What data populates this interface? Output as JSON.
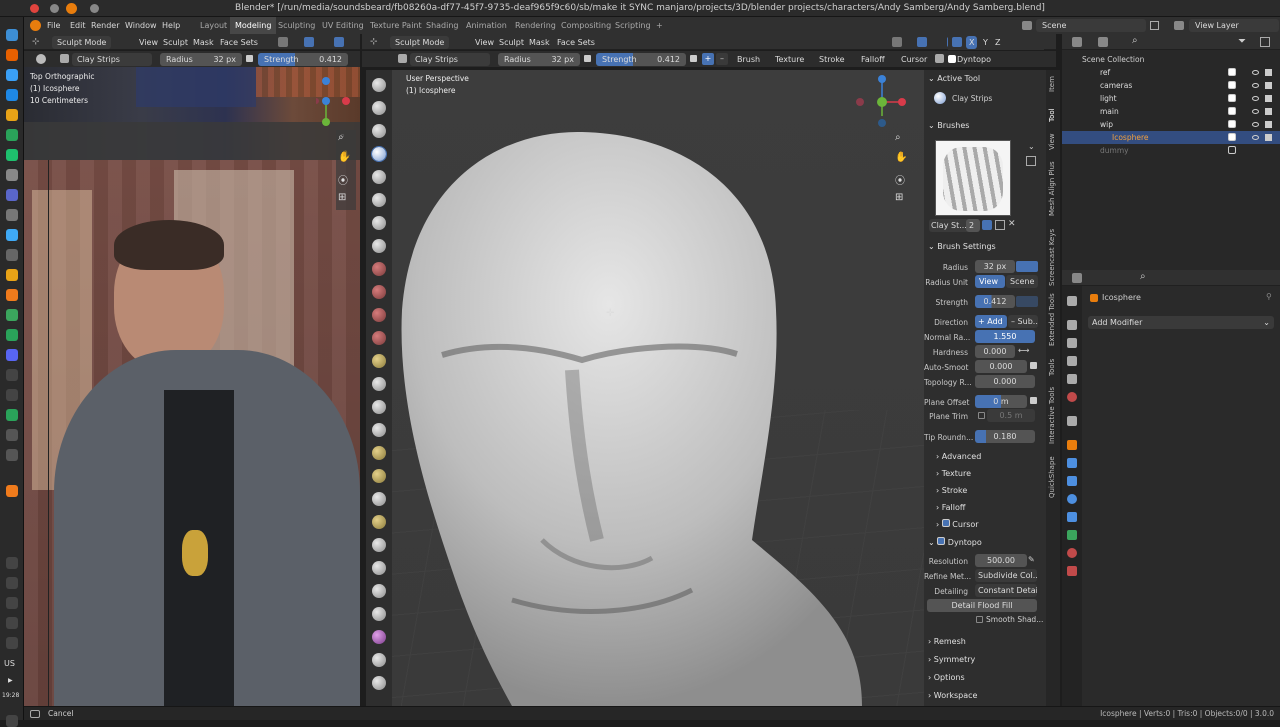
{
  "titlebar": {
    "title": "Blender* [/run/media/soundsbeard/fb08260a-df77-45f7-9735-deaf965f9c60/sb/make it SYNC manjaro/projects/3D/blender projects/characters/Andy Samberg/Andy Samberg.blend]"
  },
  "menubar": {
    "items": [
      "File",
      "Edit",
      "Render",
      "Window",
      "Help"
    ],
    "workspaces": [
      "Layout",
      "Modeling",
      "Sculpting",
      "UV Editing",
      "Texture Paint",
      "Shading",
      "Animation",
      "Rendering",
      "Compositing",
      "Scripting",
      "+"
    ],
    "active_workspace": "Modeling",
    "scene": "Scene",
    "view_layer": "View Layer"
  },
  "left_view": {
    "mode": "Sculpt Mode",
    "menus": [
      "View",
      "Sculpt",
      "Mask",
      "Face Sets"
    ],
    "brush": "Clay Strips",
    "radius_label": "Radius",
    "radius_value": "32 px",
    "strength_label": "Strength",
    "strength_value": "0.412",
    "overlay_lines": [
      "Top Orthographic",
      "(1) Icosphere",
      "10 Centimeters"
    ]
  },
  "main_view": {
    "mode": "Sculpt Mode",
    "menus": [
      "View",
      "Sculpt",
      "Mask",
      "Face Sets"
    ],
    "brush": "Clay Strips",
    "radius_label": "Radius",
    "radius_value": "32 px",
    "strength_label": "Strength",
    "strength_value": "0.412",
    "header_right": [
      "Brush",
      "Texture",
      "Stroke",
      "Falloff",
      "Cursor",
      "Dyntopo"
    ],
    "symmetry": [
      "X",
      "Y",
      "Z"
    ],
    "overlay_lines": [
      "User Perspective",
      "(1) Icosphere"
    ]
  },
  "npanel": {
    "active_tool_title": "Active Tool",
    "active_tool_name": "Clay Strips",
    "brushes_title": "Brushes",
    "brush_name": "Clay St...",
    "brush_users": "2",
    "brush_settings_title": "Brush Settings",
    "radius_label": "Radius",
    "radius_value": "32 px",
    "radius_unit_label": "Radius Unit",
    "radius_unit_view": "View",
    "radius_unit_scene": "Scene",
    "strength_label": "Strength",
    "strength_value": "0.412",
    "direction_label": "Direction",
    "direction_add": "+ Add",
    "direction_sub": "– Sub...",
    "normal_label": "Normal Ra...",
    "normal_value": "1.550",
    "hardness_label": "Hardness",
    "hardness_value": "0.000",
    "autosmooth_label": "Auto-Smoot",
    "autosmooth_value": "0.000",
    "topology_label": "Topology R...",
    "topology_value": "0.000",
    "plane_offset_label": "Plane Offset",
    "plane_offset_value": "0 m",
    "plane_trim_label": "Plane Trim",
    "plane_trim_value": "0.5 m",
    "tip_label": "Tip Roundn...",
    "tip_value": "0.180",
    "subsections": [
      "Advanced",
      "Texture",
      "Stroke",
      "Falloff",
      "Cursor"
    ],
    "dyntopo_title": "Dyntopo",
    "resolution_label": "Resolution",
    "resolution_value": "500.00",
    "refine_label": "Refine Met...",
    "refine_value": "Subdivide Col...",
    "detailing_label": "Detailing",
    "detailing_value": "Constant Detail",
    "flood_fill": "Detail Flood Fill",
    "smooth_shading": "Smooth Shad...",
    "bottom_sections": [
      "Remesh",
      "Symmetry",
      "Options",
      "Workspace"
    ],
    "tabs": [
      "Item",
      "Tool",
      "View",
      "Mesh Align Plus",
      "Screencast Keys",
      "Extended Tools",
      "Tools",
      "Interactive Tools",
      "QuickShape"
    ]
  },
  "outliner": {
    "root": "Scene Collection",
    "items": [
      {
        "name": "ref",
        "indent": 1
      },
      {
        "name": "cameras",
        "indent": 1
      },
      {
        "name": "light",
        "indent": 1
      },
      {
        "name": "main",
        "indent": 1
      },
      {
        "name": "wip",
        "indent": 1
      },
      {
        "name": "Icosphere",
        "indent": 2,
        "selected": true
      },
      {
        "name": "dummy",
        "indent": 1,
        "dim": true
      }
    ]
  },
  "properties": {
    "object": "Icosphere",
    "add_modifier": "Add Modifier"
  },
  "status": {
    "left": "Cancel",
    "right": "Icosphere | Verts:0 | Tris:0 | Objects:0/0 | 3.0.0"
  },
  "clock": {
    "time": "19:28",
    "lang": "US"
  },
  "colors": {
    "accent": "#4772b3",
    "header": "#303030",
    "panel": "#2e2e2e"
  }
}
